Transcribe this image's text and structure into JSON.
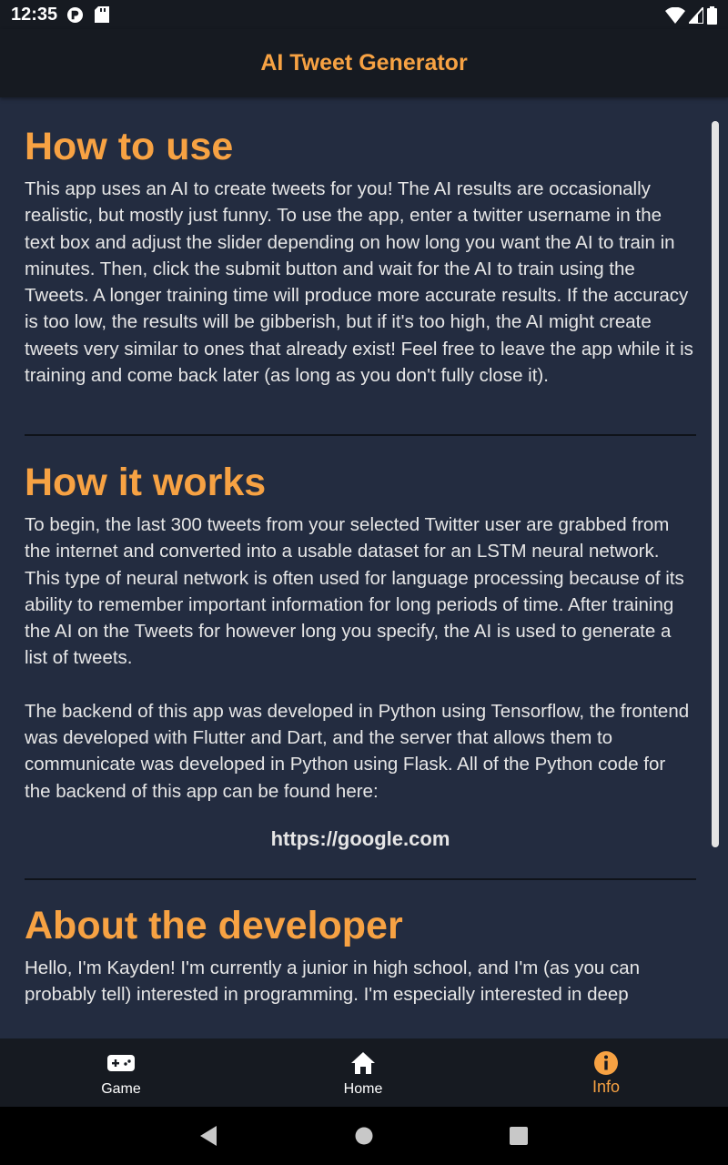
{
  "status_bar": {
    "time": "12:35",
    "icons": [
      "app-notification-icon",
      "sd-card-icon",
      "wifi-icon",
      "cell-signal-icon",
      "battery-icon"
    ]
  },
  "app_bar": {
    "title": "AI Tweet Generator"
  },
  "sections": [
    {
      "heading": "How to use",
      "paragraphs": [
        "This app uses an AI to create tweets for you! The AI results are occasionally realistic, but mostly just funny. To use the app, enter a twitter username in the text box and adjust the slider depending on how long you want the AI to train in minutes. Then, click the submit button and wait for the AI to train using the Tweets. A longer training time will produce more accurate results. If the accuracy is too low, the results will be gibberish, but if it's too high, the AI might create tweets very similar to ones that already exist! Feel free to leave the app while it is training and come back later (as long as you don't fully close it)."
      ]
    },
    {
      "heading": "How it works",
      "paragraphs": [
        "To begin, the last 300 tweets from your selected Twitter user are grabbed from the internet and converted into a usable dataset for an LSTM neural network. This type of neural network is often used for language processing because of its ability to remember important information for long periods of time. After training the AI on the Tweets for however long you specify, the AI is used to generate a list of tweets.",
        "The backend of this app was developed in Python using Tensorflow, the frontend was developed with Flutter and Dart, and the server that allows them to communicate was developed in Python using Flask. All of the Python code for the backend of this app can be found here:"
      ],
      "link": "https://google.com"
    },
    {
      "heading": "About the developer",
      "paragraphs": [
        "Hello, I'm Kayden! I'm currently a junior in high school, and I'm (as you can probably tell) interested in programming. I'm especially interested in deep"
      ]
    }
  ],
  "bottom_nav": {
    "items": [
      {
        "label": "Game",
        "icon": "gamepad-icon",
        "active": false
      },
      {
        "label": "Home",
        "icon": "home-icon",
        "active": false
      },
      {
        "label": "Info",
        "icon": "info-icon",
        "active": true
      }
    ]
  },
  "colors": {
    "accent": "#f7a243",
    "background": "#232c40",
    "bar": "#161a21"
  }
}
